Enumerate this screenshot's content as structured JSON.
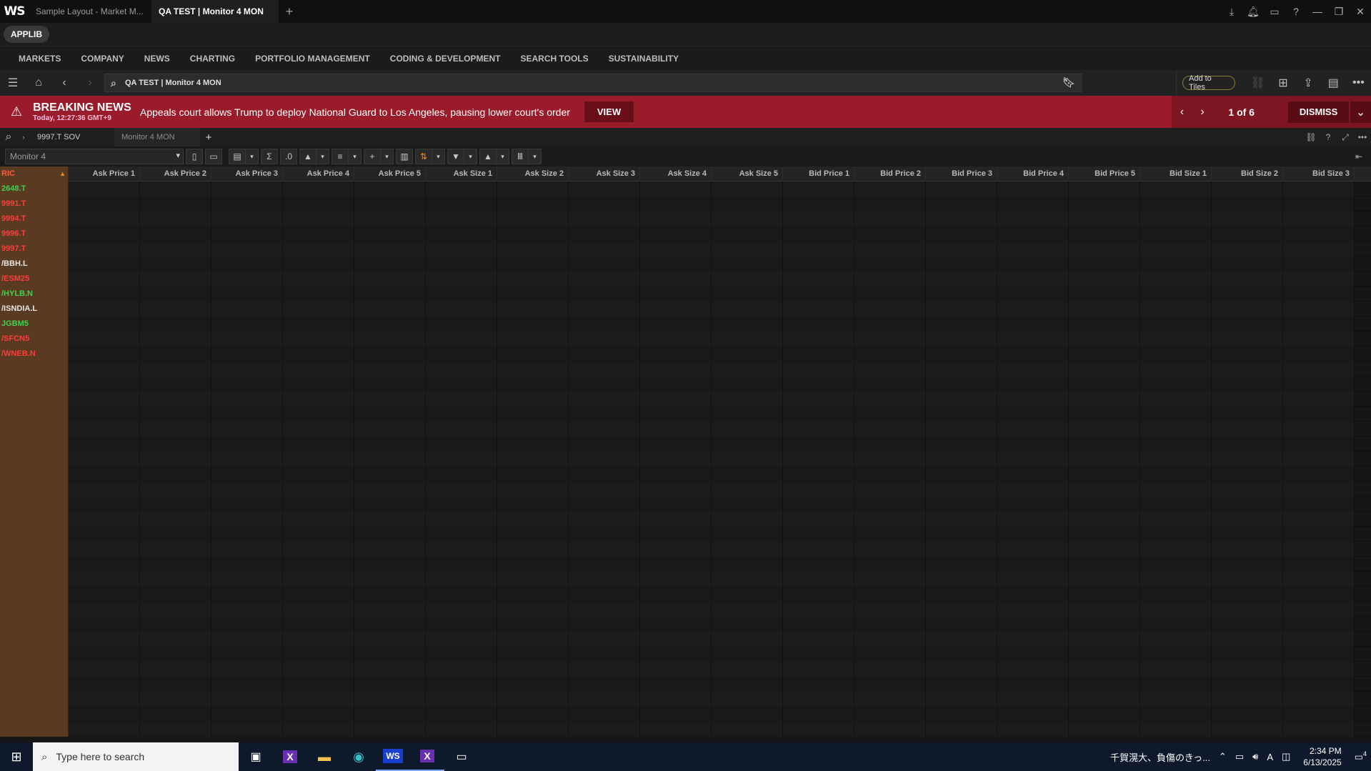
{
  "titlebar": {
    "logo": "WS",
    "tabs": [
      {
        "label": "Sample Layout - Market M..."
      },
      {
        "label": "QA TEST | Monitor 4 MON"
      }
    ],
    "add_tab": "+"
  },
  "applib": {
    "label": "APPLIB"
  },
  "menu": {
    "items": [
      "MARKETS",
      "COMPANY",
      "NEWS",
      "CHARTING",
      "PORTFOLIO MANAGEMENT",
      "CODING & DEVELOPMENT",
      "SEARCH TOOLS",
      "SUSTAINABILITY"
    ]
  },
  "nav": {
    "search_value": "QA TEST | Monitor 4 MON",
    "add_to_tiles": "Add to Tiles"
  },
  "breaking_news": {
    "title": "BREAKING NEWS",
    "time": "Today, 12:27:36 GMT+9",
    "headline": "Appeals court allows Trump to deploy National Guard to Los Angeles, pausing lower court's order",
    "view_label": "VIEW",
    "counter": "1 of 6",
    "dismiss_label": "DISMISS"
  },
  "subtabs": {
    "items": [
      {
        "label": "9997.T SOV"
      },
      {
        "label": "Monitor 4 MON"
      }
    ],
    "add": "+"
  },
  "toolbar": {
    "monitor_value": "Monitor 4"
  },
  "grid": {
    "ric_header": "RIC",
    "columns": [
      "Ask Price 1",
      "Ask Price 2",
      "Ask Price 3",
      "Ask Price 4",
      "Ask Price 5",
      "Ask Size 1",
      "Ask Size 2",
      "Ask Size 3",
      "Ask Size 4",
      "Ask Size 5",
      "Bid Price 1",
      "Bid Price 2",
      "Bid Price 3",
      "Bid Price 4",
      "Bid Price 5",
      "Bid Size 1",
      "Bid Size 2",
      "Bid Size 3"
    ],
    "rows": [
      {
        "ric": "2648.T",
        "color": "green"
      },
      {
        "ric": "9991.T",
        "color": "red"
      },
      {
        "ric": "9994.T",
        "color": "red"
      },
      {
        "ric": "9996.T",
        "color": "red"
      },
      {
        "ric": "9997.T",
        "color": "red"
      },
      {
        "ric": "/BBH.L",
        "color": "white"
      },
      {
        "ric": "/ESM25",
        "color": "red"
      },
      {
        "ric": "/HYLB.N",
        "color": "green"
      },
      {
        "ric": "/ISNDIA.L",
        "color": "white"
      },
      {
        "ric": "JGBM5",
        "color": "green"
      },
      {
        "ric": "/SFCN5",
        "color": "red"
      },
      {
        "ric": "/WNEB.N",
        "color": "red"
      }
    ],
    "empty_rows": 25
  },
  "taskbar": {
    "search_placeholder": "Type here to search",
    "weather_text": "千賀滉大、負傷のきっ...",
    "ime": "A",
    "time": "2:34 PM",
    "date": "6/13/2025",
    "notification_count": "4",
    "apps": [
      "task-view",
      "x-app",
      "file-explorer",
      "edge",
      "workspace",
      "x-app-2",
      "remote"
    ]
  },
  "colors": {
    "news_bg": "#9a1c2a",
    "ric_column_bg": "#5b3a22",
    "up": "#3fd24f",
    "down": "#ff3c3c"
  }
}
